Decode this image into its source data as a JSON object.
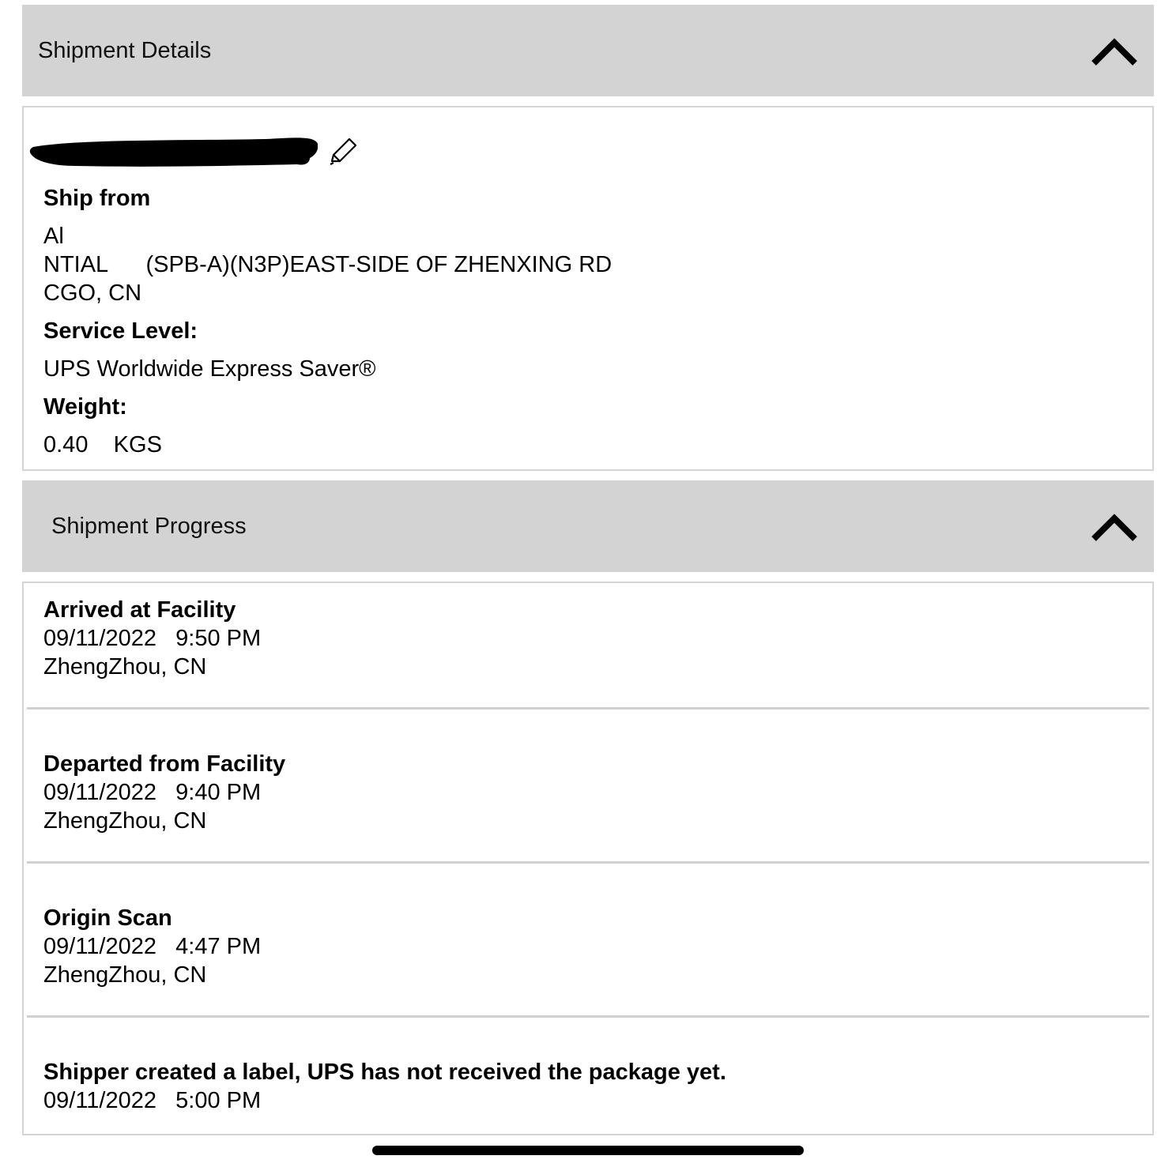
{
  "details": {
    "header_title": "Shipment Details",
    "ship_from_label": "Ship from",
    "ship_from_lines": [
      "Al",
      "NTIAL      (SPB-A)(N3P)EAST-SIDE OF ZHENXING RD",
      "CGO, CN"
    ],
    "service_level_label": "Service Level:",
    "service_level_value": "UPS Worldwide Express Saver®",
    "weight_label": "Weight:",
    "weight_value": "0.40    KGS",
    "icons": {
      "collapse": "chevron-up-icon",
      "edit": "pencil-icon"
    }
  },
  "progress": {
    "header_title": "Shipment Progress",
    "events": [
      {
        "status": "Arrived at Facility",
        "datetime": "09/11/2022   9:50 PM",
        "location": "ZhengZhou, CN"
      },
      {
        "status": "Departed from Facility",
        "datetime": "09/11/2022   9:40 PM",
        "location": "ZhengZhou, CN"
      },
      {
        "status": "Origin Scan",
        "datetime": "09/11/2022   4:47 PM",
        "location": "ZhengZhou, CN"
      },
      {
        "status": "Shipper created a label, UPS has not received the package yet.",
        "datetime": "09/11/2022   5:00 PM",
        "location": ""
      }
    ]
  },
  "colors": {
    "header_bg": "#d3d3d3",
    "panel_border": "#d4d4d4",
    "text": "#000000"
  }
}
